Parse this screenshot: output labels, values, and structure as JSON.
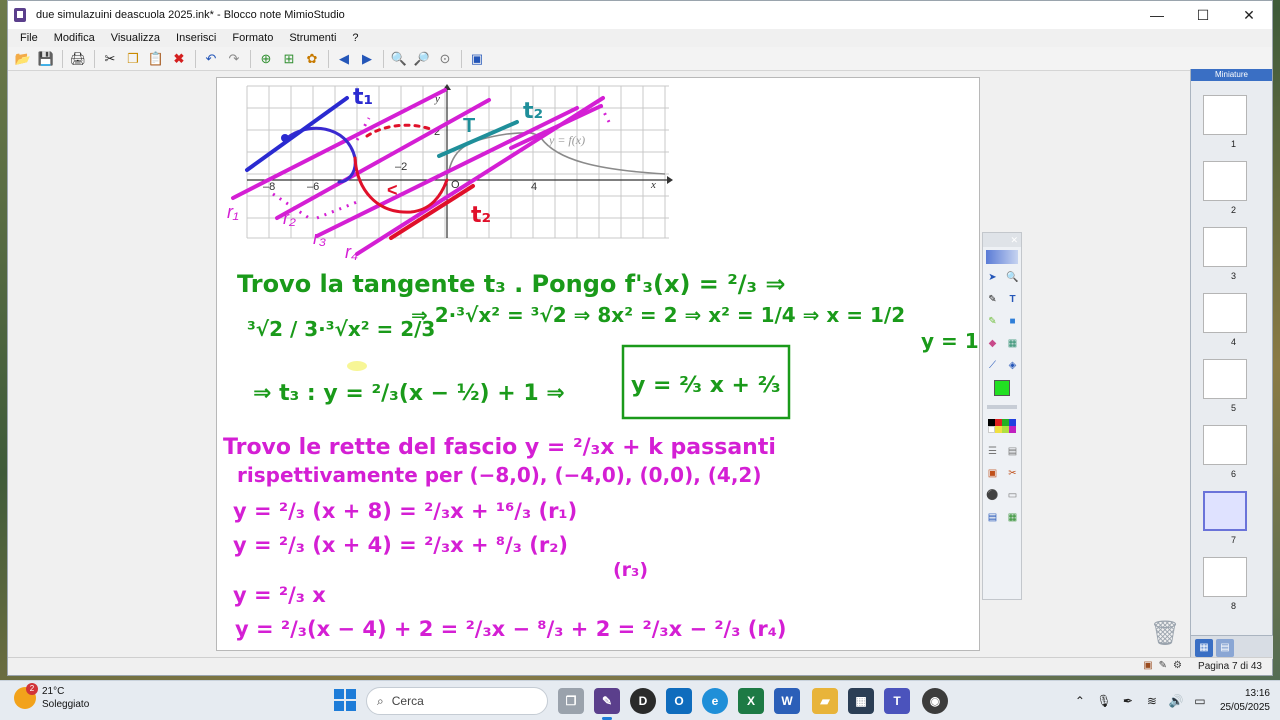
{
  "window": {
    "title": "due simulazuini deascuola 2025.ink* - Blocco note MimioStudio",
    "controls": {
      "minimize": "—",
      "maximize": "☐",
      "close": "✕"
    }
  },
  "menu": [
    "File",
    "Modifica",
    "Visualizza",
    "Inserisci",
    "Formato",
    "Strumenti",
    "?"
  ],
  "toolbar_icons": [
    "open-icon",
    "save-icon",
    "print-icon",
    "cut-icon",
    "copy-icon",
    "paste-icon",
    "delete-icon",
    "undo-icon",
    "redo-icon",
    "new-page-icon",
    "insert-page-icon",
    "group-icon",
    "back-icon",
    "forward-icon",
    "zoom-in-icon",
    "zoom-out-icon",
    "zoom-fit-icon",
    "fullscreen-icon"
  ],
  "graph": {
    "labels": {
      "t1": "t₁",
      "t2": "t₂",
      "tz": "t₂",
      "T": "T",
      "ax_x": "x",
      "ax_y": "y",
      "curve": "y = f(x)",
      "m8": "–8",
      "m6": "–6",
      "m2": "–2",
      "p4": "4",
      "y2": "2",
      "origin": "O",
      "r1": "r₁",
      "r2": "r₂",
      "r3": "r₃",
      "r4": "r₄",
      "lt": "<"
    }
  },
  "notes": {
    "l1": "Trovo la tangente t₃ . Pongo f'₃(x) = ²/₃ ⇒",
    "l2a": "³√2 / 3·³√x² = 2/3",
    "l2b": "⇒ 2·³√x² = ³√2  ⇒  8x² = 2  ⇒  x² = 1/4  ⇒  x = 1/2",
    "l2c": "y = 1",
    "l3": "⇒ t₃ : y = ²/₃(x − ½) + 1  ⇒",
    "l3box": "y = ²⁄₃ x + ²⁄₃",
    "p1": "Trovo le rette del fascio y = ²/₃x + k passanti",
    "p2": "rispettivamente per (−8,0), (−4,0), (0,0), (4,2)",
    "p3": "y = ²/₃ (x + 8) = ²/₃x + ¹⁶/₃ (r₁)",
    "p4": "y = ²/₃ (x + 4) = ²/₃x + ⁸/₃  (r₂)",
    "p4b": "(r₃)",
    "p5": "y = ²/₃ x",
    "p6": "y = ²/₃(x − 4) + 2 = ²/₃x − ⁸/₃ + 2 = ²/₃x − ²/₃  (r₄)"
  },
  "miniatures": {
    "title": "Miniature",
    "pages": [
      "1",
      "2",
      "3",
      "4",
      "5",
      "6",
      "7",
      "8"
    ],
    "selected": "7"
  },
  "status": {
    "page": "Pagina 7 di 43"
  },
  "taskbar": {
    "weather_temp": "21°C",
    "weather_desc": "Soleggiato",
    "weather_badge": "2",
    "search_placeholder": "Cerca",
    "time": "13:16",
    "date": "25/05/2025"
  },
  "colors": {
    "green": "#1a9a1a",
    "magenta": "#d41fd4",
    "red": "#e0102a",
    "blue": "#2a2ad0",
    "teal": "#1f8f9a"
  }
}
